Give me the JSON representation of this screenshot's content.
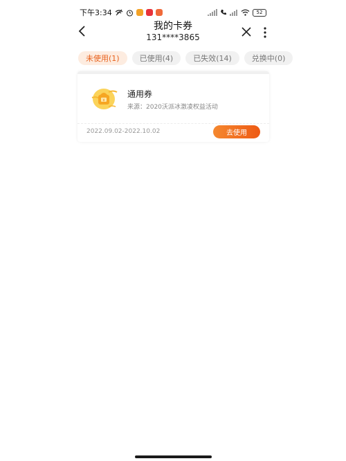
{
  "status_bar": {
    "time": "下午3:34",
    "battery": "52",
    "apps": [
      {
        "icon": "app-icon-1",
        "color": "#f3a227"
      },
      {
        "icon": "app-icon-2",
        "color": "#e8323a"
      },
      {
        "icon": "app-icon-3",
        "color": "#f06a3a"
      }
    ]
  },
  "header": {
    "title": "我的卡券",
    "subtitle": "131****3865"
  },
  "tabs": [
    {
      "name": "未使用",
      "count": "(1)",
      "active": true
    },
    {
      "name": "已使用",
      "count": "(4)",
      "active": false
    },
    {
      "name": "已失效",
      "count": "(14)",
      "active": false
    },
    {
      "name": "兑换中",
      "count": "(0)",
      "active": false
    }
  ],
  "coupon": {
    "name": "通用券",
    "source": "来源：2020沃派冰激凌权益活动",
    "validity": "2022.09.02-2022.10.02",
    "button_label": "去使用",
    "icon": "coupon-bag-icon"
  },
  "colors": {
    "accent": "#ee5a14",
    "tab_active_bg": "#fdece0",
    "tab_bg": "#f1f1f1"
  }
}
